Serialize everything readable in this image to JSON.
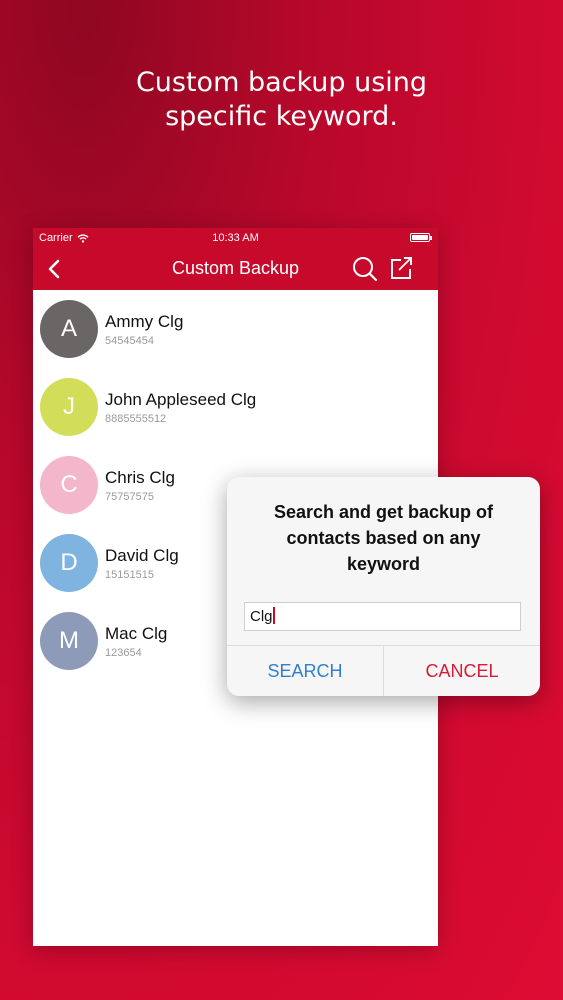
{
  "promo": {
    "line1": "Custom backup using",
    "line2": "specific keyword."
  },
  "status_bar": {
    "carrier": "Carrier",
    "time": "10:33 AM"
  },
  "nav": {
    "title": "Custom Backup",
    "icons": [
      "back-chevron-icon",
      "search-icon",
      "share-icon"
    ]
  },
  "contacts": [
    {
      "initial": "A",
      "name": "Ammy Clg",
      "number": "54545454",
      "color": "#6a6665"
    },
    {
      "initial": "J",
      "name": "John Appleseed Clg",
      "number": "8885555512",
      "color": "#d2de5a"
    },
    {
      "initial": "C",
      "name": "Chris Clg",
      "number": "75757575",
      "color": "#f3b6cb"
    },
    {
      "initial": "D",
      "name": "David Clg",
      "number": "15151515",
      "color": "#7fb3e0"
    },
    {
      "initial": "M",
      "name": "Mac Clg",
      "number": "123654",
      "color": "#8d9bb8"
    }
  ],
  "dialog": {
    "line1": "Search and get backup of",
    "line2": "contacts based on any",
    "line3": "keyword",
    "input_value": "Clg",
    "search_label": "SEARCH",
    "cancel_label": "CANCEL"
  },
  "colors": {
    "accent": "#c70a2c",
    "search_button": "#2f7fd1",
    "cancel_button": "#d81b36"
  }
}
